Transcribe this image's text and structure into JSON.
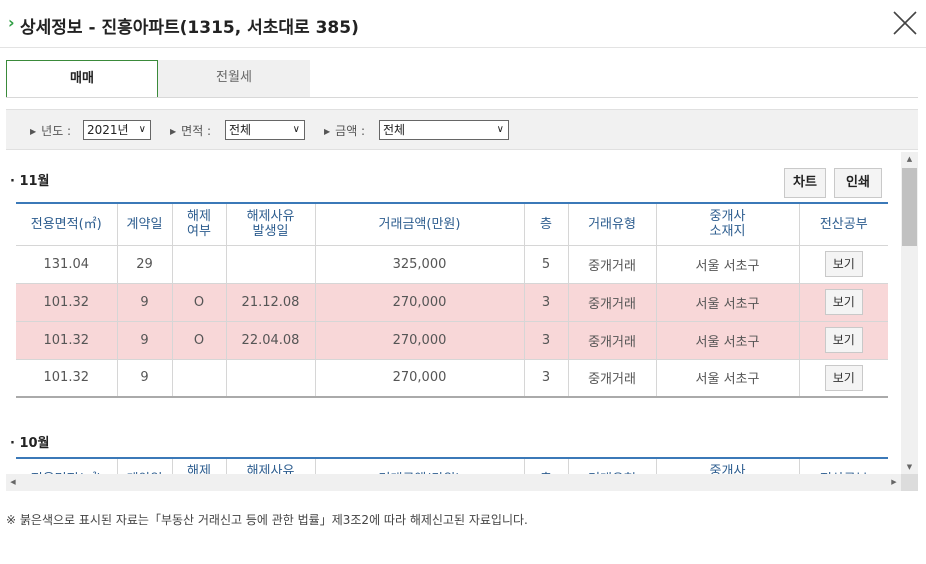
{
  "header": {
    "chevron": "›",
    "title": "상세정보 - 진흥아파트(1315, 서초대로 385)"
  },
  "tabs": [
    {
      "label": "매매"
    },
    {
      "label": "전월세"
    }
  ],
  "filters": {
    "year": {
      "label": "년도 :",
      "value": "2021년"
    },
    "area": {
      "label": "면적 :",
      "value": "전체"
    },
    "price": {
      "label": "금액 :",
      "value": "전체"
    }
  },
  "buttons": {
    "chart": "차트",
    "print": "인쇄"
  },
  "table": {
    "headers": [
      "전용면적(㎡)",
      "계약일",
      "해제\n여부",
      "해제사유\n발생일",
      "거래금액(만원)",
      "층",
      "거래유형",
      "중개사\n소재지",
      "전산공부"
    ]
  },
  "months": [
    {
      "label": "· 11월",
      "rows": [
        {
          "area": "131.04",
          "day": "29",
          "cancel": "",
          "cancel_date": "",
          "price": "325,000",
          "floor": "5",
          "type": "중개거래",
          "location": "서울 서초구",
          "btn": "보기",
          "cancelled": false
        },
        {
          "area": "101.32",
          "day": "9",
          "cancel": "O",
          "cancel_date": "21.12.08",
          "price": "270,000",
          "floor": "3",
          "type": "중개거래",
          "location": "서울 서초구",
          "btn": "보기",
          "cancelled": true
        },
        {
          "area": "101.32",
          "day": "9",
          "cancel": "O",
          "cancel_date": "22.04.08",
          "price": "270,000",
          "floor": "3",
          "type": "중개거래",
          "location": "서울 서초구",
          "btn": "보기",
          "cancelled": true
        },
        {
          "area": "101.32",
          "day": "9",
          "cancel": "",
          "cancel_date": "",
          "price": "270,000",
          "floor": "3",
          "type": "중개거래",
          "location": "서울 서초구",
          "btn": "보기",
          "cancelled": false
        }
      ]
    },
    {
      "label": "· 10월",
      "rows": []
    }
  ],
  "footnote": "※ 붉은색으로 표시된 자료는「부동산 거래신고 등에 관한 법률」제3조2에 따라 해제신고된 자료입니다."
}
